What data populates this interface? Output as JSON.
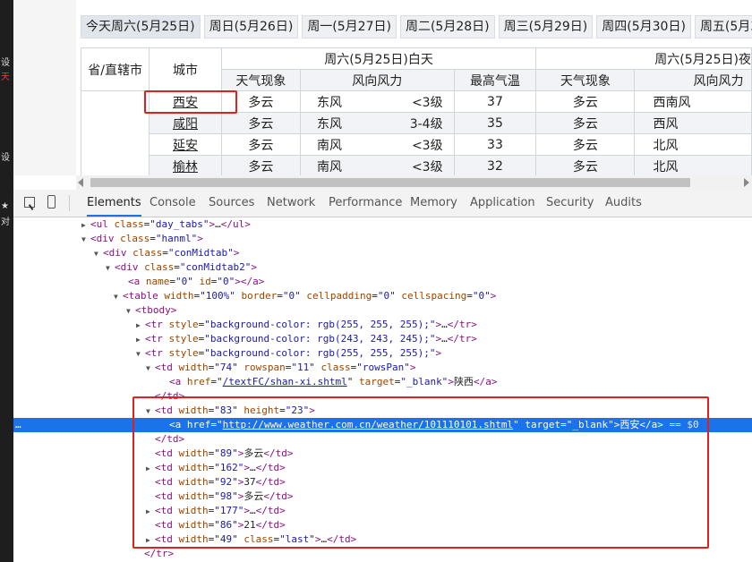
{
  "left_strip": {
    "glyphs": [
      "设",
      "天",
      "设",
      "★",
      "对"
    ]
  },
  "tabs": [
    "今天周六(5月25日)",
    "周日(5月26日)",
    "周一(5月27日)",
    "周二(5月28日)",
    "周三(5月29日)",
    "周四(5月30日)",
    "周五(5月31日)"
  ],
  "table": {
    "header": {
      "province": "省/直辖市",
      "city": "城市",
      "day_group": "周六(5月25日)白天",
      "night_group": "周六(5月25日)夜",
      "weather": "天气现象",
      "wind": "风向风力",
      "max_temp": "最高气温",
      "night_weather": "天气现象",
      "night_wind": "风向风力"
    },
    "rows": [
      {
        "city": "西安",
        "weather": "多云",
        "wind_dir": "东风",
        "wind_force": "<3级",
        "max_temp": "37",
        "night_weather": "多云",
        "night_wind": "西南风"
      },
      {
        "city": "咸阳",
        "weather": "多云",
        "wind_dir": "东风",
        "wind_force": "3-4级",
        "max_temp": "35",
        "night_weather": "多云",
        "night_wind": "西风"
      },
      {
        "city": "延安",
        "weather": "多云",
        "wind_dir": "南风",
        "wind_force": "<3级",
        "max_temp": "33",
        "night_weather": "多云",
        "night_wind": "北风"
      },
      {
        "city": "榆林",
        "weather": "多云",
        "wind_dir": "南风",
        "wind_force": "<3级",
        "max_temp": "32",
        "night_weather": "多云",
        "night_wind": "北风"
      }
    ]
  },
  "devtools": {
    "tabs": [
      "Elements",
      "Console",
      "Sources",
      "Network",
      "Performance",
      "Memory",
      "Application",
      "Security",
      "Audits"
    ],
    "active_tab": "Elements",
    "gutter_dots": "…",
    "lines": [
      {
        "indent": 74,
        "tri": "▶",
        "html": "ul_day_tabs"
      },
      {
        "indent": 74,
        "tri": "▼",
        "html": "div_hanml"
      },
      {
        "indent": 90,
        "tri": "▼",
        "html": "div_conMidtab"
      },
      {
        "indent": 106,
        "tri": "▼",
        "html": "div_conMidtab2"
      }
    ],
    "text": {
      "ul": "ul",
      "class": "class",
      "day_tabs": "\"day_tabs\"",
      "ellipsis": "…",
      "div": "div",
      "hanml": "\"hanml\"",
      "conMidtab": "\"conMidtab\"",
      "conMidtab2": "\"conMidtab2\"",
      "a": "a",
      "name": "name",
      "id": "id",
      "zero": "\"0\"",
      "table": "table",
      "width": "width",
      "w100": "\"100%\"",
      "border": "border",
      "cellpadding": "cellpadding",
      "cellspacing": "cellspacing",
      "tbody": "tbody",
      "tr": "tr",
      "style": "style",
      "bg255": "\"background-color: rgb(255, 255, 255);\"",
      "bg243": "\"background-color: rgb(243, 243, 245);\"",
      "bg255b": "\"background-color: rgb(255, 255, 255);\"",
      "td": "td",
      "w74": "\"74\"",
      "rowspan": "rowspan",
      "r11": "\"11\"",
      "rowsPan": "\"rowsPan\"",
      "href": "href",
      "shanxi_link": "/textFC/shan-xi.shtml",
      "target": "target",
      "blank": "\"_blank\"",
      "shanxi": "陕西",
      "w83": "\"83\"",
      "height": "height",
      "h23": "\"23\"",
      "xian_link": "http://www.weather.com.cn/weather/101110101.shtml",
      "xian": "西安",
      "eq_dollar": " == $0",
      "w89": "\"89\"",
      "duoyun1": "多云",
      "w162": "\"162\"",
      "w92": "\"92\"",
      "t37": "37",
      "w98": "\"98\"",
      "duoyun2": "多云",
      "w177": "\"177\"",
      "w86": "\"86\"",
      "t21": "21",
      "w49": "\"49\"",
      "last": "\"last\""
    }
  },
  "colors": {
    "highlight_border": "#e02020",
    "selected_row": "#1a73e8",
    "tag": "#881280",
    "attr": "#994500",
    "value": "#1a1aa6"
  }
}
